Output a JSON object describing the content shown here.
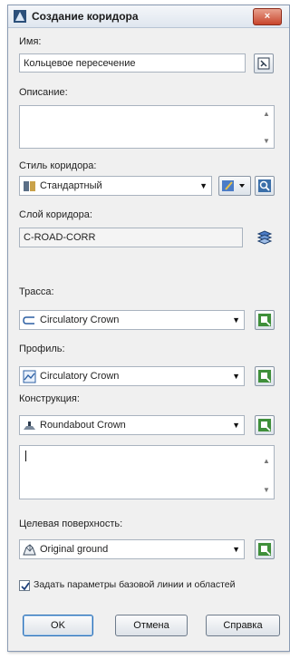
{
  "dialog": {
    "title": "Создание коридора",
    "close_label": "×"
  },
  "name": {
    "label": "Имя:",
    "value": "Кольцевое пересечение"
  },
  "description": {
    "label": "Описание:",
    "value": ""
  },
  "corridor_style": {
    "label": "Стиль коридора:",
    "value": "Стандартный"
  },
  "corridor_layer": {
    "label": "Слой коридора:",
    "value": "C-ROAD-CORR"
  },
  "alignment": {
    "label": "Трасса:",
    "value": "Circulatory Crown"
  },
  "profile": {
    "label": "Профиль:",
    "value": "Circulatory Crown"
  },
  "assembly": {
    "label": "Конструкция:",
    "value": "Roundabout Crown",
    "notes": ""
  },
  "target_surface": {
    "label": "Целевая поверхность:",
    "value": "Original ground"
  },
  "set_params": {
    "label": "Задать параметры базовой линии и областей",
    "checked": true
  },
  "buttons": {
    "ok": "OK",
    "cancel": "Отмена",
    "help": "Справка"
  },
  "colors": {
    "titlebar": "#dfe6ef",
    "close": "#c8452c",
    "green_icon": "#3f8f3a"
  }
}
